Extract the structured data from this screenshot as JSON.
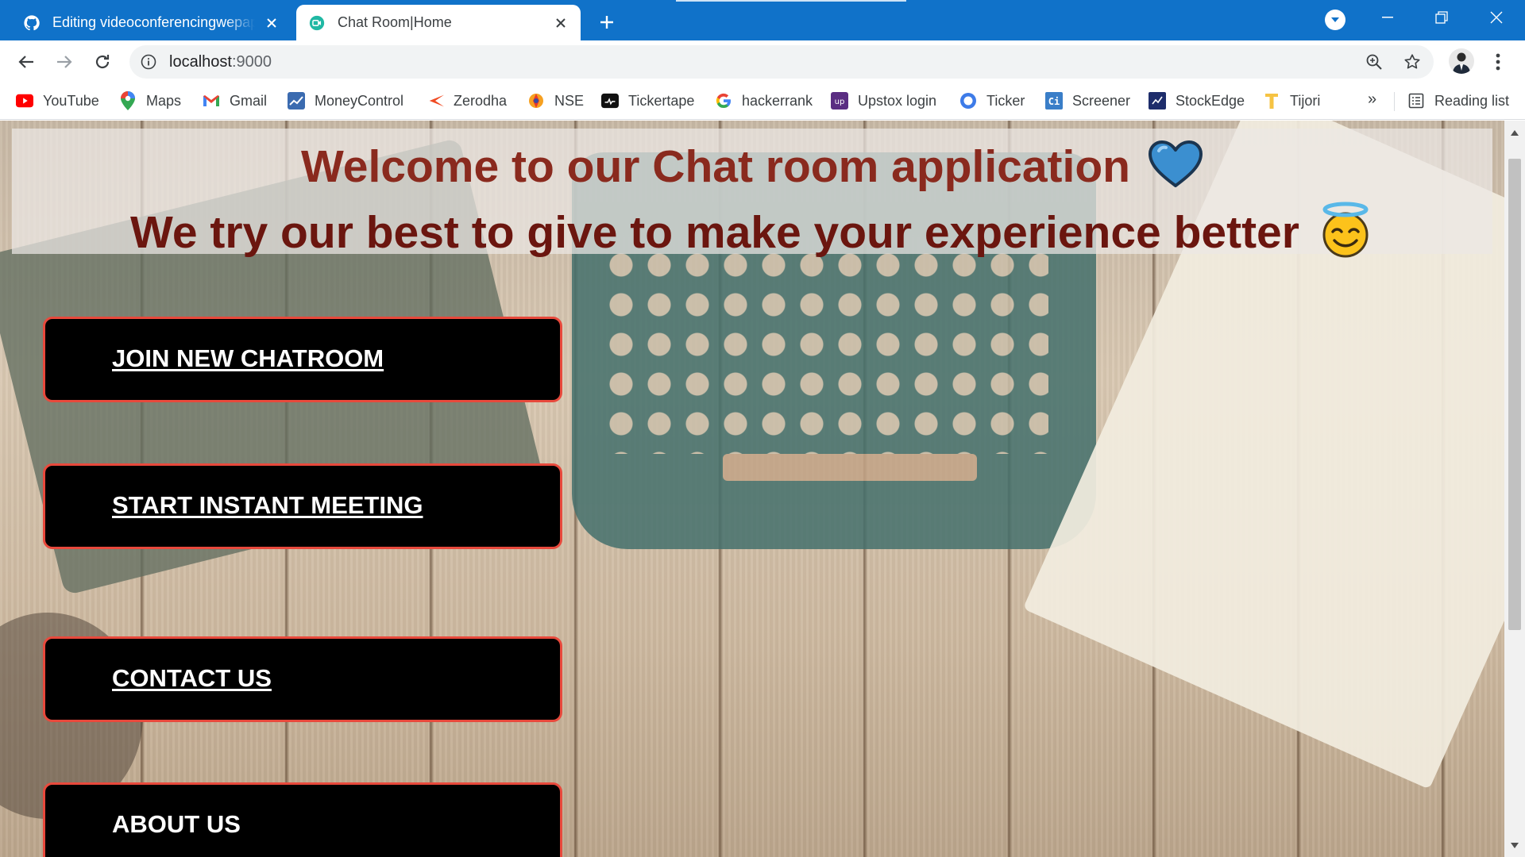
{
  "browser": {
    "tabs": [
      {
        "title": "Editing videoconferencingwepapp",
        "icon": "github-icon",
        "active": false
      },
      {
        "title": "Chat Room|Home",
        "icon": "chatroom-favicon",
        "active": true
      }
    ],
    "url": {
      "host": "localhost",
      "port": ":9000"
    },
    "bookmarks": [
      {
        "label": "YouTube",
        "icon": "youtube-icon"
      },
      {
        "label": "Maps",
        "icon": "maps-icon"
      },
      {
        "label": "Gmail",
        "icon": "gmail-icon"
      },
      {
        "label": "MoneyControl",
        "icon": "moneycontrol-icon"
      },
      {
        "label": "Zerodha",
        "icon": "zerodha-icon"
      },
      {
        "label": "NSE",
        "icon": "nse-icon"
      },
      {
        "label": "Tickertape",
        "icon": "tickertape-icon"
      },
      {
        "label": "hackerrank",
        "icon": "google-icon"
      },
      {
        "label": "Upstox login",
        "icon": "upstox-icon"
      },
      {
        "label": "Ticker",
        "icon": "ticker-icon"
      },
      {
        "label": "Screener",
        "icon": "screener-icon"
      },
      {
        "label": "StockEdge",
        "icon": "stockedge-icon"
      },
      {
        "label": "Tijori",
        "icon": "tijori-icon"
      }
    ],
    "more_bookmarks": "»",
    "reading_list": "Reading list",
    "colors": {
      "titlebar": "#1072c9"
    }
  },
  "page": {
    "hero": {
      "line1": "Welcome to our Chat room application",
      "line1_emoji": "blue-heart-icon",
      "line2": "We try our best to give to make your experience better",
      "line2_emoji": "smiling-face-with-halo-icon"
    },
    "menu": [
      {
        "label": "JOIN NEW CHATROOM",
        "underlined": true
      },
      {
        "label": "START INSTANT MEETING",
        "underlined": true
      },
      {
        "label": "CONTACT US",
        "underlined": true
      },
      {
        "label": "ABOUT US",
        "underlined": false
      }
    ],
    "colors": {
      "hero_text": "#7a1e16",
      "card_bg": "#000000",
      "card_border": "#e8493c",
      "card_text": "#ffffff"
    }
  }
}
